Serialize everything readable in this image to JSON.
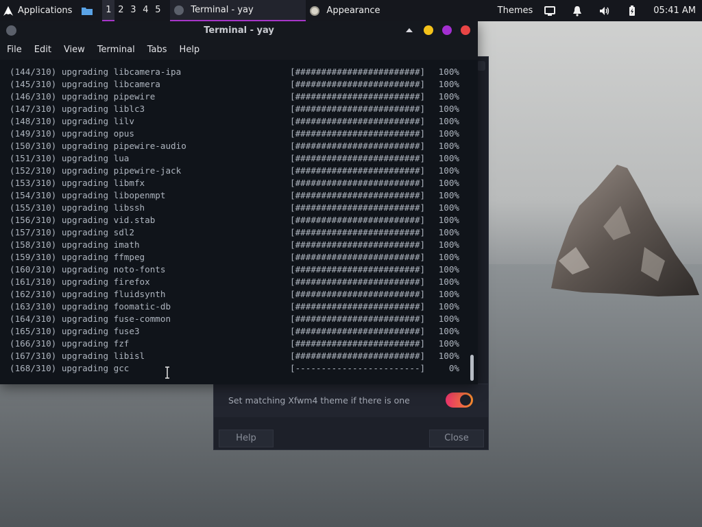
{
  "panel": {
    "applications_label": "Applications",
    "workspaces": [
      "1",
      "2",
      "3",
      "4",
      "5"
    ],
    "active_workspace": "1",
    "tasks": [
      {
        "label": "Terminal - yay",
        "icon": "terminal-icon",
        "active": true
      },
      {
        "label": "Appearance",
        "icon": "appearance-icon",
        "active": false
      }
    ],
    "themes_label": "Themes",
    "clock": "05:41 AM",
    "accent": "#a736c9"
  },
  "terminal": {
    "title": "Terminal - yay",
    "menu": [
      "File",
      "Edit",
      "View",
      "Terminal",
      "Tabs",
      "Help"
    ],
    "lines": [
      {
        "text": "(144/310) upgrading libcamera-ipa",
        "bar": "[########################]",
        "pct": "100%"
      },
      {
        "text": "(145/310) upgrading libcamera",
        "bar": "[########################]",
        "pct": "100%"
      },
      {
        "text": "(146/310) upgrading pipewire",
        "bar": "[########################]",
        "pct": "100%"
      },
      {
        "text": "(147/310) upgrading liblc3",
        "bar": "[########################]",
        "pct": "100%"
      },
      {
        "text": "(148/310) upgrading lilv",
        "bar": "[########################]",
        "pct": "100%"
      },
      {
        "text": "(149/310) upgrading opus",
        "bar": "[########################]",
        "pct": "100%"
      },
      {
        "text": "(150/310) upgrading pipewire-audio",
        "bar": "[########################]",
        "pct": "100%"
      },
      {
        "text": "(151/310) upgrading lua",
        "bar": "[########################]",
        "pct": "100%"
      },
      {
        "text": "(152/310) upgrading pipewire-jack",
        "bar": "[########################]",
        "pct": "100%"
      },
      {
        "text": "(153/310) upgrading libmfx",
        "bar": "[########################]",
        "pct": "100%"
      },
      {
        "text": "(154/310) upgrading libopenmpt",
        "bar": "[########################]",
        "pct": "100%"
      },
      {
        "text": "(155/310) upgrading libssh",
        "bar": "[########################]",
        "pct": "100%"
      },
      {
        "text": "(156/310) upgrading vid.stab",
        "bar": "[########################]",
        "pct": "100%"
      },
      {
        "text": "(157/310) upgrading sdl2",
        "bar": "[########################]",
        "pct": "100%"
      },
      {
        "text": "(158/310) upgrading imath",
        "bar": "[########################]",
        "pct": "100%"
      },
      {
        "text": "(159/310) upgrading ffmpeg",
        "bar": "[########################]",
        "pct": "100%"
      },
      {
        "text": "(160/310) upgrading noto-fonts",
        "bar": "[########################]",
        "pct": "100%"
      },
      {
        "text": "(161/310) upgrading firefox",
        "bar": "[########################]",
        "pct": "100%"
      },
      {
        "text": "(162/310) upgrading fluidsynth",
        "bar": "[########################]",
        "pct": "100%"
      },
      {
        "text": "(163/310) upgrading foomatic-db",
        "bar": "[########################]",
        "pct": "100%"
      },
      {
        "text": "(164/310) upgrading fuse-common",
        "bar": "[########################]",
        "pct": "100%"
      },
      {
        "text": "(165/310) upgrading fuse3",
        "bar": "[########################]",
        "pct": "100%"
      },
      {
        "text": "(166/310) upgrading fzf",
        "bar": "[########################]",
        "pct": "100%"
      },
      {
        "text": "(167/310) upgrading libisl",
        "bar": "[########################]",
        "pct": "100%"
      },
      {
        "text": "(168/310) upgrading gcc",
        "bar": "[------------------------]",
        "pct": "0%"
      }
    ]
  },
  "appearance": {
    "xfwm_label": "Set matching Xfwm4 theme if there is one",
    "xfwm_toggle_on": true,
    "help_label": "Help",
    "close_label": "Close"
  }
}
